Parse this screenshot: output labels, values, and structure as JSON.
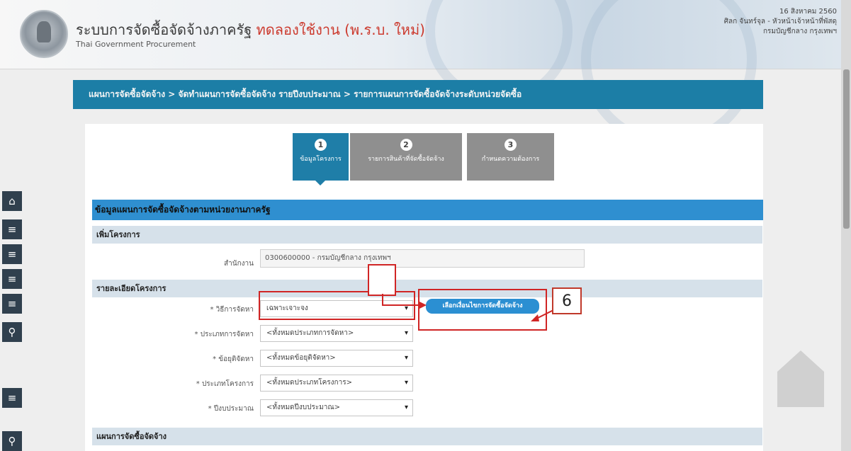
{
  "header": {
    "title_main": "ระบบการจัดซื้อจัดจ้างภาครัฐ",
    "title_highlight": "ทดลองใช้งาน (พ.ร.บ. ใหม่)",
    "subtitle": "Thai Government Procurement",
    "date": "16 สิงหาคม 2560",
    "user_line1": "ศิลก จันทร์จุล - หัวหน้าเจ้าหน้าที่พัสดุ",
    "user_line2": "กรมบัญชีกลาง กรุงเทพฯ"
  },
  "sidebar": {
    "icons": [
      "home-icon",
      "menu-icon",
      "menu-icon",
      "menu-icon",
      "menu-icon",
      "search-icon",
      "menu-icon",
      "search-icon"
    ],
    "glyphs": [
      "⌂",
      "≡",
      "≡",
      "≡",
      "≡",
      "⚲",
      "≡",
      "⚲"
    ]
  },
  "breadcrumb": "แผนการจัดซื้อจัดจ้าง > จัดทำแผนการจัดซื้อจัดจ้าง รายปีงบประมาณ > รายการแผนการจัดซื้อจัดจ้างระดับหน่วยจัดซื้อ",
  "steps": [
    {
      "num": "1",
      "label": "ข้อมูลโครงการ"
    },
    {
      "num": "2",
      "label": "รายการสินค้าที่จัดซื้อจัดจ้าง"
    },
    {
      "num": "3",
      "label": "กำหนดความต้องการ"
    }
  ],
  "section_title": "ข้อมูลแผนการจัดซื้อจัดจ้างตามหน่วยงานภาครัฐ",
  "add_project": {
    "bar_label": "เพิ่มโครงการ",
    "office_label": "สำนักงาน",
    "office_value": "0300600000 - กรมบัญชีกลาง กรุงเทพฯ"
  },
  "project_details": {
    "bar_label": "รายละเอียดโครงการ",
    "fields": [
      {
        "label": "* วิธีการจัดหา",
        "value": "เฉพาะเจาะจง"
      },
      {
        "label": "* ประเภทการจัดหา",
        "value": "<ทั้งหมดประเภทการจัดหา>"
      },
      {
        "label": "* ข้อยุติจัดหา",
        "value": "<ทั้งหมดข้อยุติจัดหา>"
      },
      {
        "label": "* ประเภทโครงการ",
        "value": "<ทั้งหมดประเภทโครงการ>"
      },
      {
        "label": "* ปีงบประมาณ",
        "value": "<ทั้งหมดปีงบประมาณ>"
      }
    ],
    "select_button": "เลือกเงื่อนไขการจัดซื้อจัดจ้าง"
  },
  "plan_bar_label": "แผนการจัดซื้อจัดจ้าง",
  "annotation_number": "6",
  "colors": {
    "breadcrumb": "#1c7ea6",
    "step_active": "#1f7ea8",
    "step_inactive": "#8f8f8f",
    "section": "#2f8fd0",
    "sub_bar": "#d6e1ea",
    "annotation": "#d02525"
  }
}
